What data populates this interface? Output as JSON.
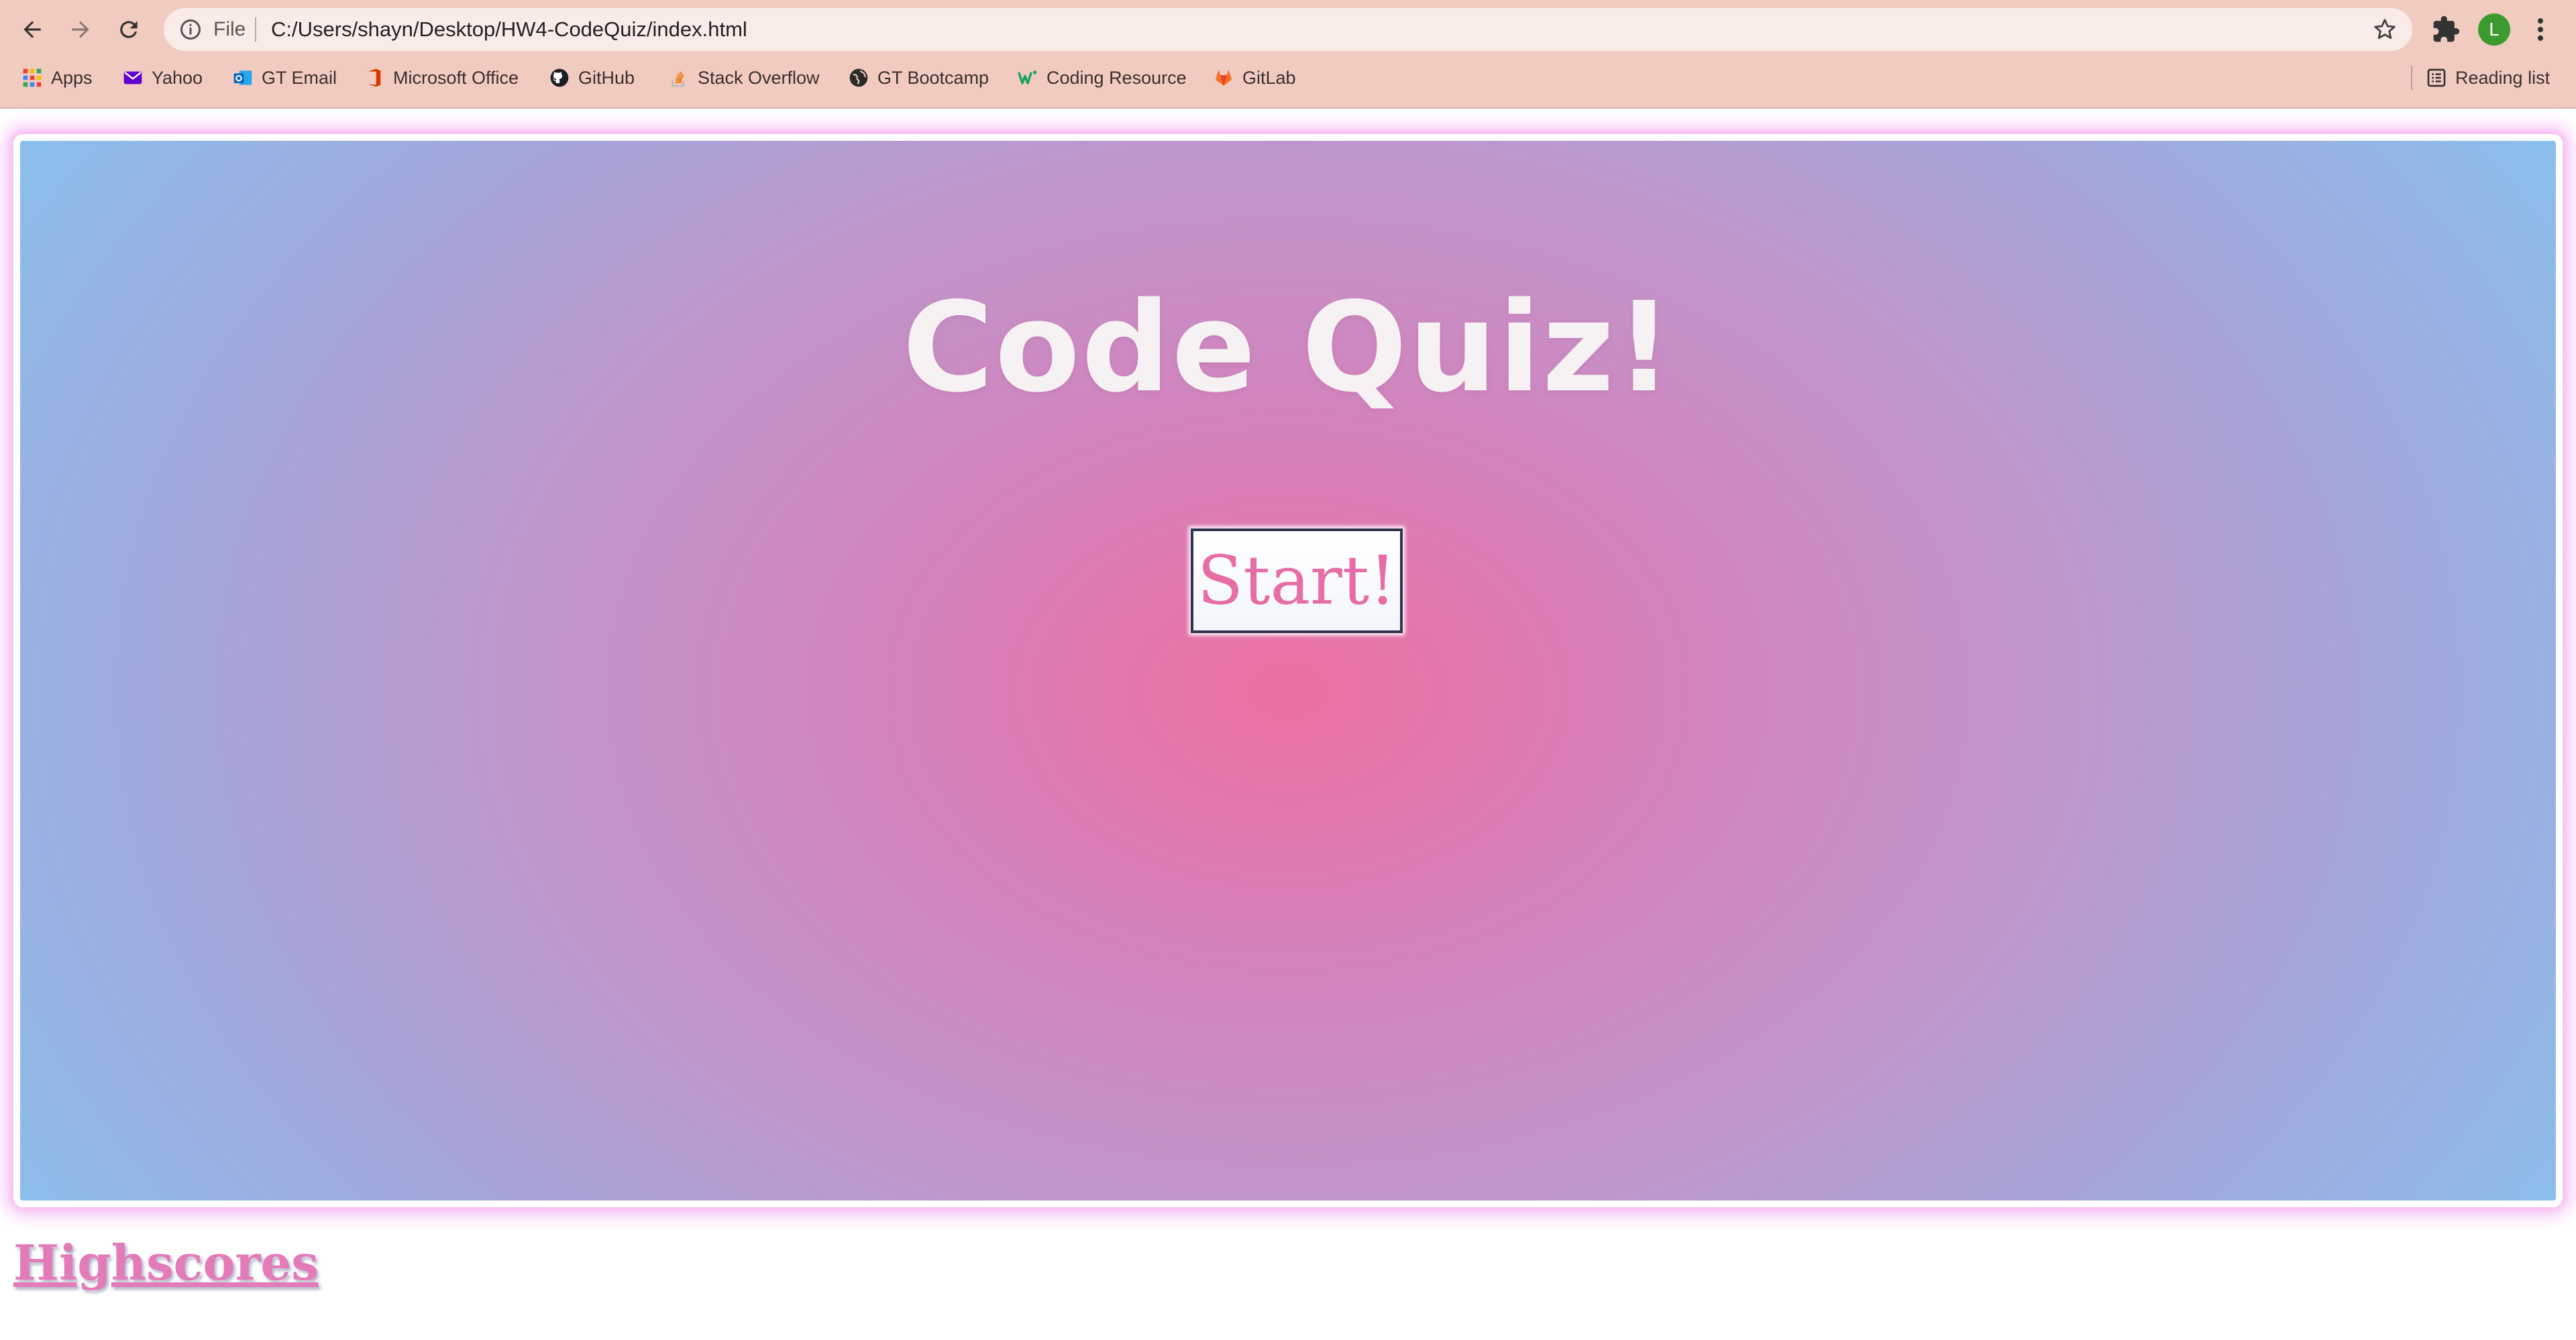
{
  "browser": {
    "scheme_label": "File",
    "url": "C:/Users/shayn/Desktop/HW4-CodeQuiz/index.html",
    "profile_initial": "L",
    "bookmarks": [
      {
        "label": "Apps",
        "icon": "apps-grid-icon"
      },
      {
        "label": "Yahoo",
        "icon": "yahoo-icon"
      },
      {
        "label": "GT Email",
        "icon": "outlook-icon"
      },
      {
        "label": "Microsoft Office",
        "icon": "office-icon"
      },
      {
        "label": "GitHub",
        "icon": "github-icon"
      },
      {
        "label": "Stack Overflow",
        "icon": "stackoverflow-icon"
      },
      {
        "label": "GT Bootcamp",
        "icon": "globe-icon"
      },
      {
        "label": "Coding Resource",
        "icon": "w-icon"
      },
      {
        "label": "GitLab",
        "icon": "gitlab-icon"
      }
    ],
    "reading_list": "Reading list"
  },
  "page": {
    "title": "Code Quiz!",
    "start_label": "Start!",
    "highscores_label": "Highscores"
  },
  "colors": {
    "chrome_bg": "#f1cbc0",
    "gradient_center": "#ec6fa1",
    "gradient_edge": "#88c1ee",
    "accent_pink": "#e66da5"
  }
}
